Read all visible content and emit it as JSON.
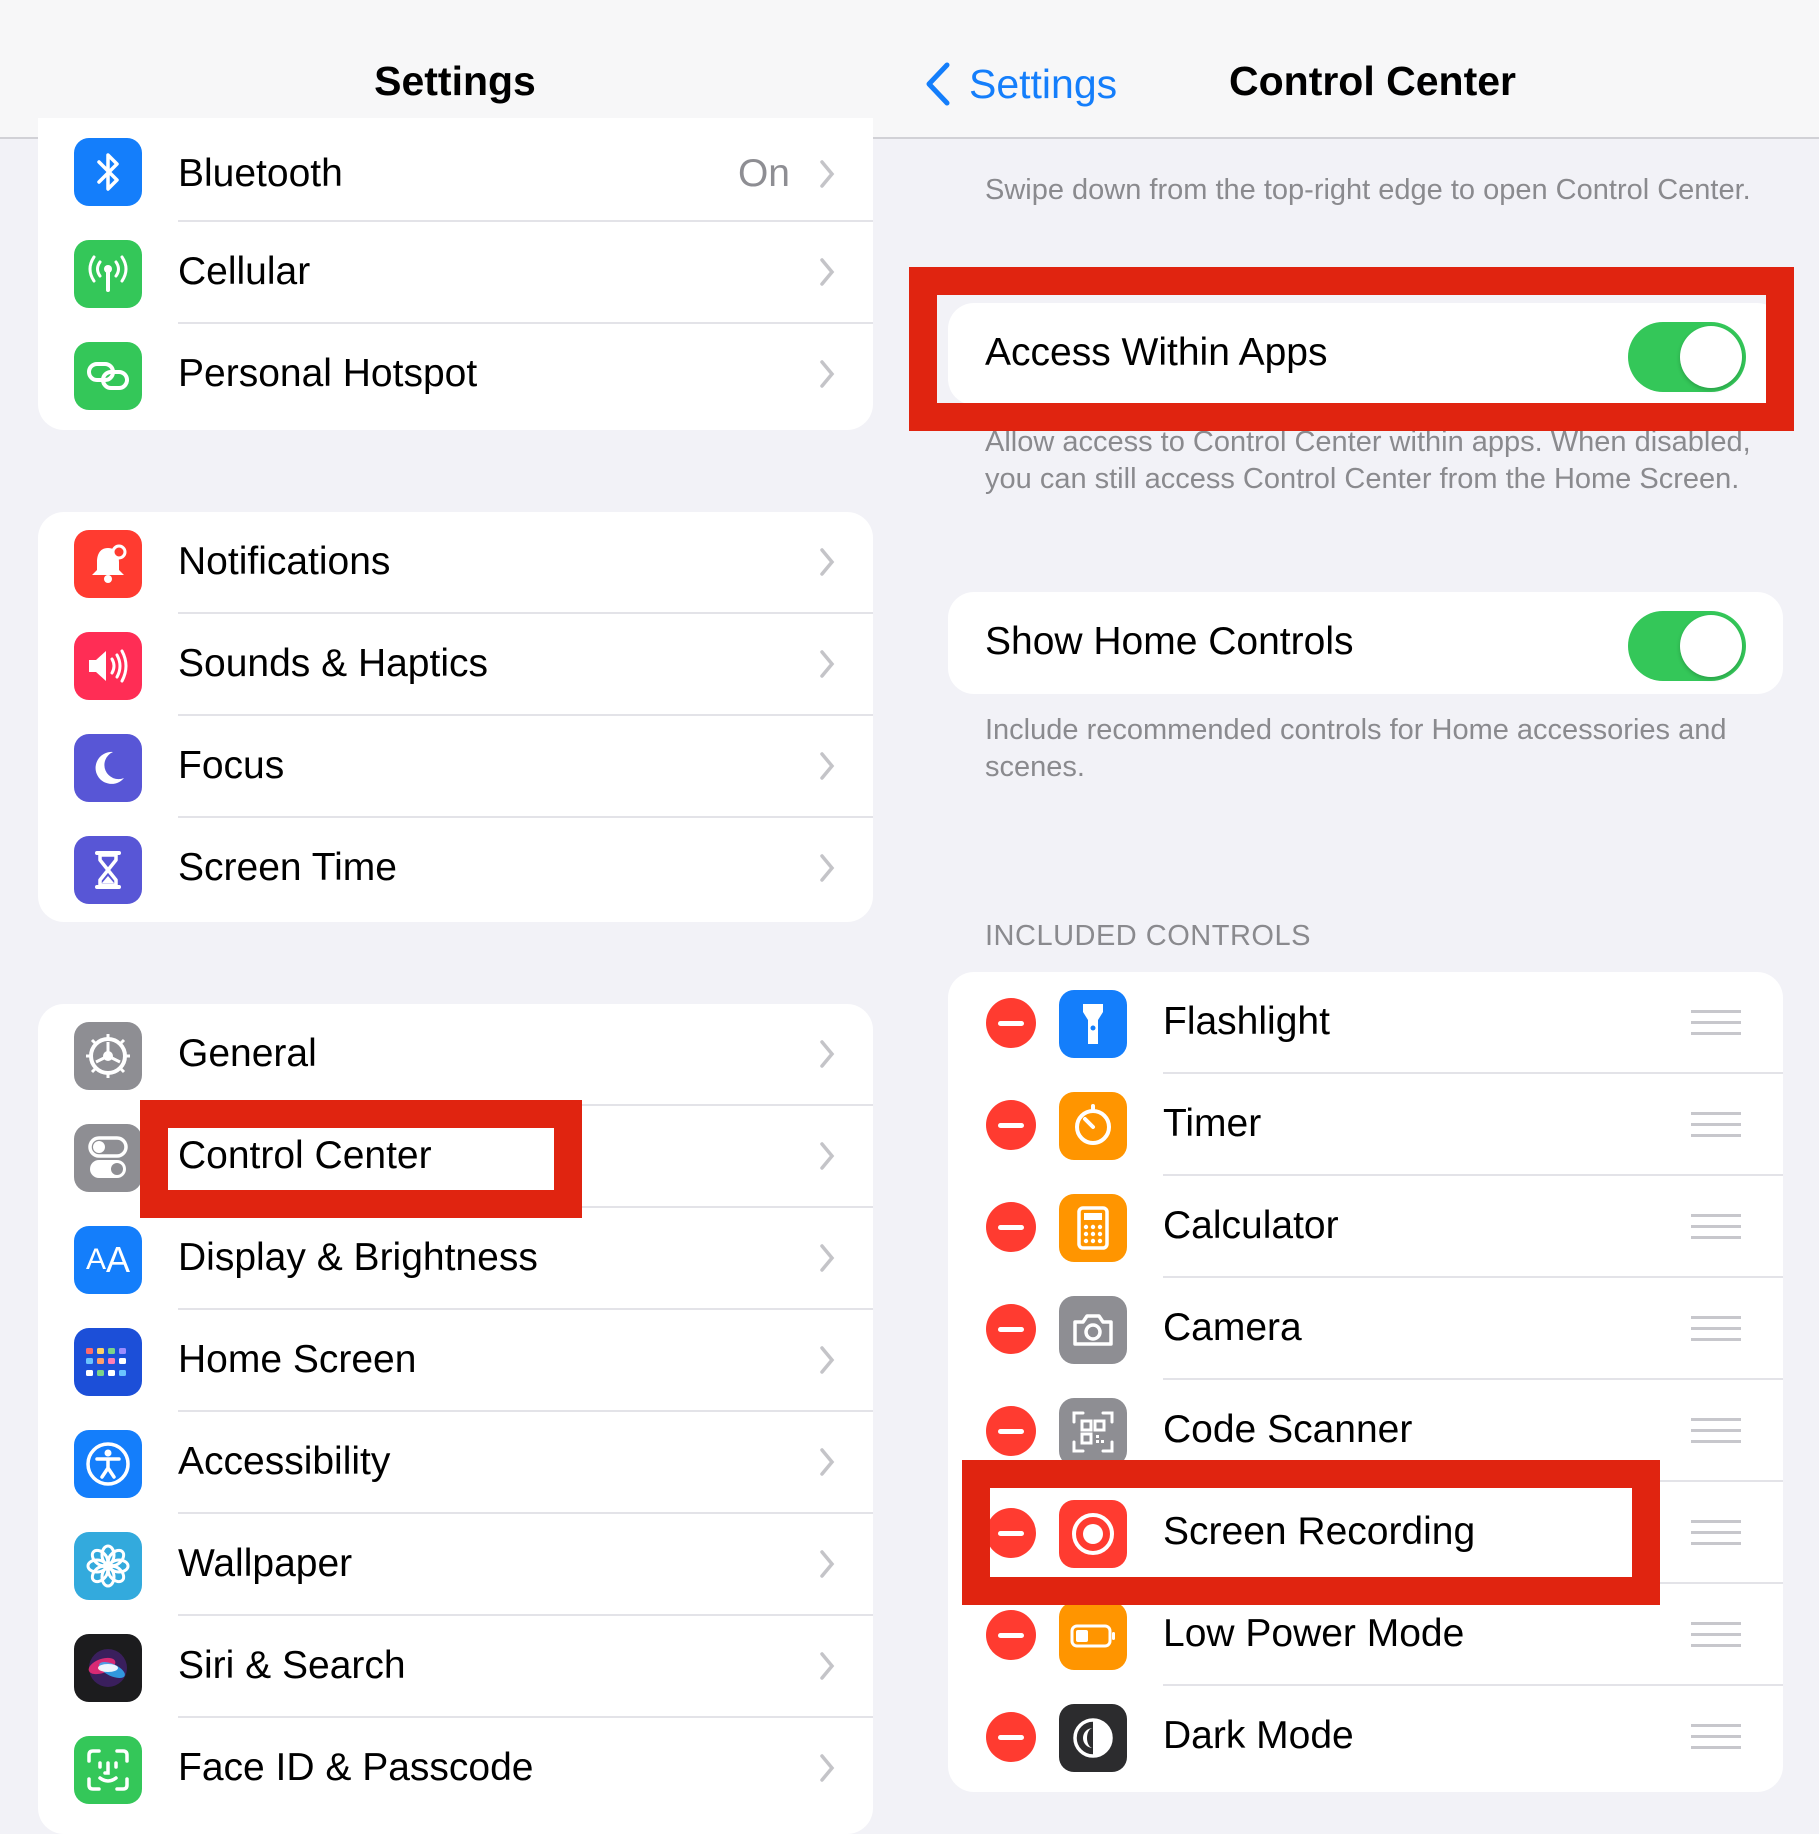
{
  "left": {
    "title": "Settings",
    "group1": [
      {
        "label": "Bluetooth",
        "value": "On",
        "icon": "bluetooth-icon",
        "color": "#147efb"
      },
      {
        "label": "Cellular",
        "value": "",
        "icon": "cellular-icon",
        "color": "#34c759"
      },
      {
        "label": "Personal Hotspot",
        "value": "",
        "icon": "hotspot-icon",
        "color": "#34c759"
      }
    ],
    "group2": [
      {
        "label": "Notifications",
        "icon": "notifications-icon",
        "color": "#ff3b30"
      },
      {
        "label": "Sounds & Haptics",
        "icon": "speaker-icon",
        "color": "#ff2d55"
      },
      {
        "label": "Focus",
        "icon": "moon-icon",
        "color": "#5856d6"
      },
      {
        "label": "Screen Time",
        "icon": "hourglass-icon",
        "color": "#5856d6"
      }
    ],
    "group3": [
      {
        "label": "General",
        "icon": "gear-icon",
        "color": "#8e8e93"
      },
      {
        "label": "Control Center",
        "icon": "switches-icon",
        "color": "#8e8e93"
      },
      {
        "label": "Display & Brightness",
        "icon": "text-size-icon",
        "color": "#147efb"
      },
      {
        "label": "Home Screen",
        "icon": "home-screen-icon",
        "color": "#1c4fd8"
      },
      {
        "label": "Accessibility",
        "icon": "accessibility-icon",
        "color": "#147efb"
      },
      {
        "label": "Wallpaper",
        "icon": "flower-icon",
        "color": "#33aadd"
      },
      {
        "label": "Siri & Search",
        "icon": "siri-icon",
        "color": "#222222"
      },
      {
        "label": "Face ID & Passcode",
        "icon": "face-id-icon",
        "color": "#34c759"
      }
    ]
  },
  "right": {
    "back_label": "Settings",
    "title": "Control Center",
    "intro": "Swipe down from the top-right edge to open Control Center.",
    "access_within_apps": {
      "label": "Access Within Apps",
      "on": true
    },
    "access_note": "Allow access to Control Center within apps. When disabled, you can still access Control Center from the Home Screen.",
    "show_home_controls": {
      "label": "Show Home Controls",
      "on": true
    },
    "home_note": "Include recommended controls for Home accessories and scenes.",
    "included_header": "INCLUDED CONTROLS",
    "controls": [
      {
        "label": "Flashlight",
        "icon": "flashlight-icon",
        "color": "#147efb"
      },
      {
        "label": "Timer",
        "icon": "timer-icon",
        "color": "#ff9500"
      },
      {
        "label": "Calculator",
        "icon": "calculator-icon",
        "color": "#ff9500"
      },
      {
        "label": "Camera",
        "icon": "camera-icon",
        "color": "#8e8e93"
      },
      {
        "label": "Code Scanner",
        "icon": "qr-code-icon",
        "color": "#8e8e93"
      },
      {
        "label": "Screen Recording",
        "icon": "record-icon",
        "color": "#ff3b30"
      },
      {
        "label": "Low Power Mode",
        "icon": "battery-icon",
        "color": "#ff9500"
      },
      {
        "label": "Dark Mode",
        "icon": "dark-mode-icon",
        "color": "#2c2c2e"
      }
    ]
  },
  "highlight_color": "#e02410"
}
